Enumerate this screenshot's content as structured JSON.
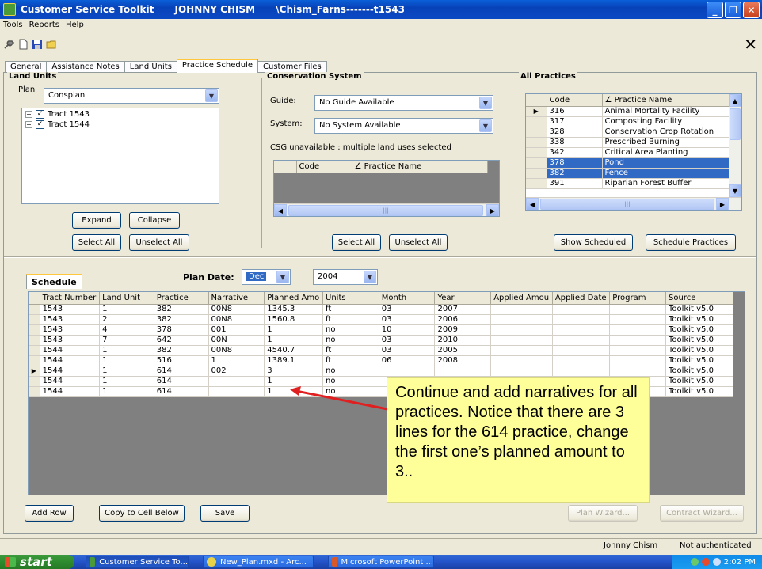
{
  "window": {
    "title_parts": [
      "Customer Service Toolkit",
      "JOHNNY CHISM",
      "\\Chism_Farns-------t1543"
    ],
    "min": "_",
    "max": "❐",
    "close": "✕"
  },
  "menu": [
    "Tools",
    "Reports",
    "Help"
  ],
  "big_close": "✕",
  "tabs": [
    "General",
    "Assistance Notes",
    "Land Units",
    "Practice Schedule",
    "Customer Files"
  ],
  "active_tab": "Practice Schedule",
  "land_units": {
    "title": "Land Units",
    "plan_label": "Plan",
    "plan_value": "Consplan",
    "tracts": [
      "Tract 1543",
      "Tract 1544"
    ],
    "expand": "Expand",
    "collapse": "Collapse",
    "select_all": "Select All",
    "unselect_all": "Unselect All"
  },
  "conservation": {
    "title": "Conservation System",
    "guide_label": "Guide:",
    "guide_value": "No Guide Available",
    "system_label": "System:",
    "system_value": "No System Available",
    "csg_note": "CSG unavailable : multiple land uses selected",
    "col_code": "Code",
    "col_name": "Practice Name",
    "select_all": "Select All",
    "unselect_all": "Unselect All"
  },
  "all_practices": {
    "title": "All Practices",
    "col_code": "Code",
    "col_name": "Practice Name",
    "rows": [
      {
        "code": "316",
        "name": "Animal Mortality Facility"
      },
      {
        "code": "317",
        "name": "Composting Facility"
      },
      {
        "code": "328",
        "name": "Conservation Crop Rotation"
      },
      {
        "code": "338",
        "name": "Prescribed Burning"
      },
      {
        "code": "342",
        "name": "Critical Area Planting"
      },
      {
        "code": "378",
        "name": "Pond"
      },
      {
        "code": "382",
        "name": "Fence"
      },
      {
        "code": "391",
        "name": "Riparian Forest Buffer"
      }
    ],
    "show_scheduled": "Show Scheduled",
    "schedule_practices": "Schedule Practices"
  },
  "schedule": {
    "tab": "Schedule",
    "plan_date_label": "Plan Date:",
    "month": "Dec",
    "year": "2004",
    "columns": [
      "Tract Number",
      "Land Unit",
      "Practice",
      "Narrative",
      "Planned Amo",
      "Units",
      "Month",
      "Year",
      "Applied Amou",
      "Applied Date",
      "Program",
      "Source"
    ],
    "rows": [
      [
        "1543",
        "1",
        "382",
        "00N8",
        "1345.3",
        "ft",
        "03",
        "2007",
        "",
        "",
        "",
        "Toolkit v5.0"
      ],
      [
        "1543",
        "2",
        "382",
        "00N8",
        "1560.8",
        "ft",
        "03",
        "2006",
        "",
        "",
        "",
        "Toolkit v5.0"
      ],
      [
        "1543",
        "4",
        "378",
        "001",
        "1",
        "no",
        "10",
        "2009",
        "",
        "",
        "",
        "Toolkit v5.0"
      ],
      [
        "1543",
        "7",
        "642",
        "00N",
        "1",
        "no",
        "03",
        "2010",
        "",
        "",
        "",
        "Toolkit v5.0"
      ],
      [
        "1544",
        "1",
        "382",
        "00N8",
        "4540.7",
        "ft",
        "03",
        "2005",
        "",
        "",
        "",
        "Toolkit v5.0"
      ],
      [
        "1544",
        "1",
        "516",
        "1",
        "1389.1",
        "ft",
        "06",
        "2008",
        "",
        "",
        "",
        "Toolkit v5.0"
      ],
      [
        "1544",
        "1",
        "614",
        "002",
        "3",
        "no",
        "",
        "",
        "",
        "",
        "",
        "Toolkit v5.0"
      ],
      [
        "1544",
        "1",
        "614",
        "",
        "1",
        "no",
        "",
        "",
        "",
        "",
        "",
        "Toolkit v5.0"
      ],
      [
        "1544",
        "1",
        "614",
        "",
        "1",
        "no",
        "",
        "",
        "",
        "",
        "",
        "Toolkit v5.0"
      ]
    ],
    "add_row": "Add Row",
    "copy_below": "Copy to Cell Below",
    "save": "Save",
    "plan_wizard": "Plan Wizard...",
    "contract_wizard": "Contract Wizard..."
  },
  "callout": "Continue and add narratives for all practices. Notice that there are 3 lines for the 614 practice, change the first one’s planned amount to 3..",
  "status": {
    "user": "Johnny Chism",
    "auth": "Not authenticated"
  },
  "taskbar": {
    "start": "start",
    "tasks": [
      "Customer Service To...",
      "New_Plan.mxd - Arc...",
      "Microsoft PowerPoint ..."
    ],
    "clock": "2:02 PM"
  },
  "colors": {
    "titlebar": "#0842b8",
    "selection": "#316ac5",
    "callout": "#ffff99",
    "arrow": "#e02020"
  }
}
